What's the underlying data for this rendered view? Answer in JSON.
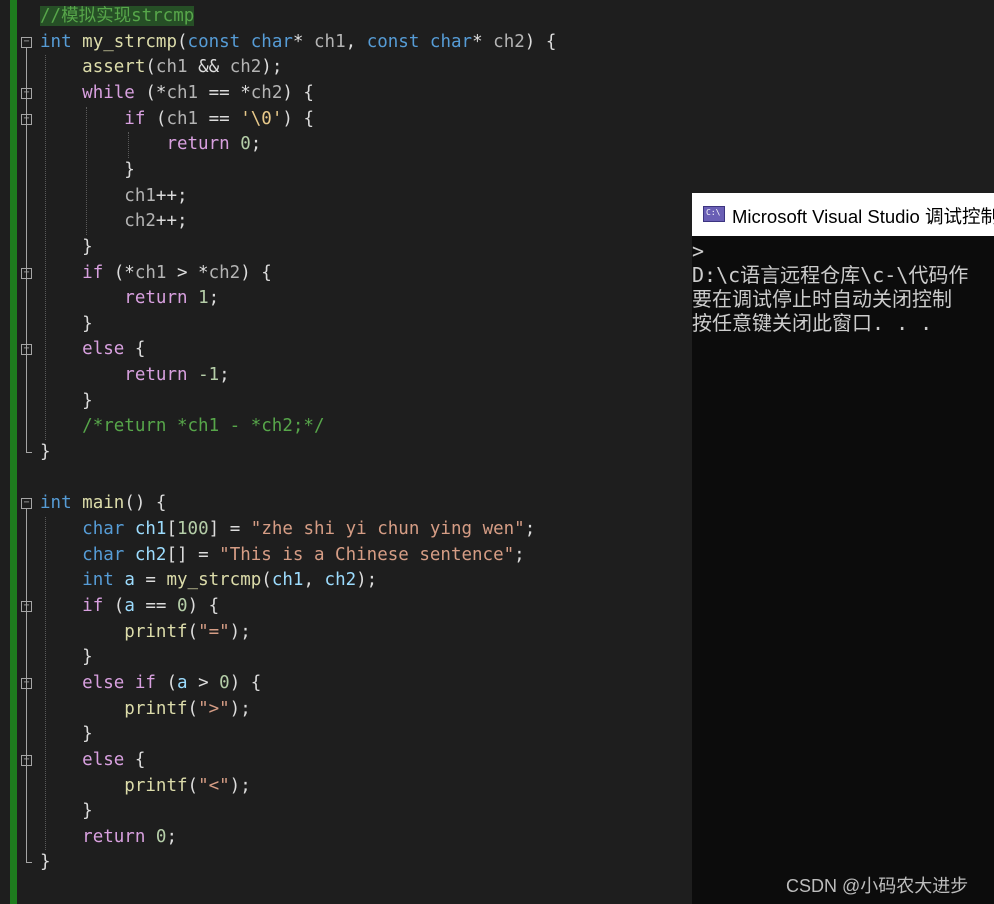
{
  "editor": {
    "lines": [
      {
        "tokens": [
          {
            "t": "//模拟实现strcmp",
            "c": "cmt cmt-hl"
          }
        ]
      },
      {
        "tokens": [
          {
            "t": "int",
            "c": "kw"
          },
          {
            "t": " ",
            "c": "plain"
          },
          {
            "t": "my_strcmp",
            "c": "fn"
          },
          {
            "t": "(",
            "c": "plain"
          },
          {
            "t": "const",
            "c": "kw"
          },
          {
            "t": " ",
            "c": "plain"
          },
          {
            "t": "char",
            "c": "kw"
          },
          {
            "t": "* ",
            "c": "plain"
          },
          {
            "t": "ch1",
            "c": "gray"
          },
          {
            "t": ", ",
            "c": "plain"
          },
          {
            "t": "const",
            "c": "kw"
          },
          {
            "t": " ",
            "c": "plain"
          },
          {
            "t": "char",
            "c": "kw"
          },
          {
            "t": "* ",
            "c": "plain"
          },
          {
            "t": "ch2",
            "c": "gray"
          },
          {
            "t": ") {",
            "c": "plain"
          }
        ]
      },
      {
        "tokens": [
          {
            "t": "    ",
            "c": "plain"
          },
          {
            "t": "assert",
            "c": "fn"
          },
          {
            "t": "(",
            "c": "plain"
          },
          {
            "t": "ch1",
            "c": "gray"
          },
          {
            "t": " && ",
            "c": "plain"
          },
          {
            "t": "ch2",
            "c": "gray"
          },
          {
            "t": ");",
            "c": "plain"
          }
        ]
      },
      {
        "tokens": [
          {
            "t": "    ",
            "c": "plain"
          },
          {
            "t": "while",
            "c": "ctl"
          },
          {
            "t": " (*",
            "c": "plain"
          },
          {
            "t": "ch1",
            "c": "gray"
          },
          {
            "t": " == *",
            "c": "plain"
          },
          {
            "t": "ch2",
            "c": "gray"
          },
          {
            "t": ") {",
            "c": "plain"
          }
        ]
      },
      {
        "tokens": [
          {
            "t": "        ",
            "c": "plain"
          },
          {
            "t": "if",
            "c": "ctl"
          },
          {
            "t": " (",
            "c": "plain"
          },
          {
            "t": "ch1",
            "c": "gray"
          },
          {
            "t": " == ",
            "c": "plain"
          },
          {
            "t": "'\\0'",
            "c": "chr"
          },
          {
            "t": ") {",
            "c": "plain"
          }
        ]
      },
      {
        "tokens": [
          {
            "t": "            ",
            "c": "plain"
          },
          {
            "t": "return",
            "c": "ctl"
          },
          {
            "t": " ",
            "c": "plain"
          },
          {
            "t": "0",
            "c": "num"
          },
          {
            "t": ";",
            "c": "plain"
          }
        ]
      },
      {
        "tokens": [
          {
            "t": "        }",
            "c": "plain"
          }
        ]
      },
      {
        "tokens": [
          {
            "t": "        ",
            "c": "plain"
          },
          {
            "t": "ch1",
            "c": "gray"
          },
          {
            "t": "++;",
            "c": "plain"
          }
        ]
      },
      {
        "tokens": [
          {
            "t": "        ",
            "c": "plain"
          },
          {
            "t": "ch2",
            "c": "gray"
          },
          {
            "t": "++;",
            "c": "plain"
          }
        ]
      },
      {
        "tokens": [
          {
            "t": "    }",
            "c": "plain"
          }
        ]
      },
      {
        "tokens": [
          {
            "t": "    ",
            "c": "plain"
          },
          {
            "t": "if",
            "c": "ctl"
          },
          {
            "t": " (*",
            "c": "plain"
          },
          {
            "t": "ch1",
            "c": "gray"
          },
          {
            "t": " > *",
            "c": "plain"
          },
          {
            "t": "ch2",
            "c": "gray"
          },
          {
            "t": ") {",
            "c": "plain"
          }
        ]
      },
      {
        "tokens": [
          {
            "t": "        ",
            "c": "plain"
          },
          {
            "t": "return",
            "c": "ctl"
          },
          {
            "t": " ",
            "c": "plain"
          },
          {
            "t": "1",
            "c": "num"
          },
          {
            "t": ";",
            "c": "plain"
          }
        ]
      },
      {
        "tokens": [
          {
            "t": "    }",
            "c": "plain"
          }
        ]
      },
      {
        "tokens": [
          {
            "t": "    ",
            "c": "plain"
          },
          {
            "t": "else",
            "c": "ctl"
          },
          {
            "t": " {",
            "c": "plain"
          }
        ]
      },
      {
        "tokens": [
          {
            "t": "        ",
            "c": "plain"
          },
          {
            "t": "return",
            "c": "ctl"
          },
          {
            "t": " ",
            "c": "plain"
          },
          {
            "t": "-1",
            "c": "num"
          },
          {
            "t": ";",
            "c": "plain"
          }
        ]
      },
      {
        "tokens": [
          {
            "t": "    }",
            "c": "plain"
          }
        ]
      },
      {
        "tokens": [
          {
            "t": "    ",
            "c": "plain"
          },
          {
            "t": "/*return *ch1 - *ch2;*/",
            "c": "cmt"
          }
        ]
      },
      {
        "tokens": [
          {
            "t": "}",
            "c": "plain"
          }
        ]
      },
      {
        "tokens": [
          {
            "t": "",
            "c": "plain"
          }
        ]
      },
      {
        "tokens": [
          {
            "t": "int",
            "c": "kw"
          },
          {
            "t": " ",
            "c": "plain"
          },
          {
            "t": "main",
            "c": "fn"
          },
          {
            "t": "() {",
            "c": "plain"
          }
        ]
      },
      {
        "tokens": [
          {
            "t": "    ",
            "c": "plain"
          },
          {
            "t": "char",
            "c": "kw"
          },
          {
            "t": " ",
            "c": "plain"
          },
          {
            "t": "ch1",
            "c": "var"
          },
          {
            "t": "[",
            "c": "plain"
          },
          {
            "t": "100",
            "c": "num"
          },
          {
            "t": "] = ",
            "c": "plain"
          },
          {
            "t": "\"zhe shi yi chun ying wen\"",
            "c": "str"
          },
          {
            "t": ";",
            "c": "plain"
          }
        ]
      },
      {
        "tokens": [
          {
            "t": "    ",
            "c": "plain"
          },
          {
            "t": "char",
            "c": "kw"
          },
          {
            "t": " ",
            "c": "plain"
          },
          {
            "t": "ch2",
            "c": "var"
          },
          {
            "t": "[] = ",
            "c": "plain"
          },
          {
            "t": "\"This is a Chinese sentence\"",
            "c": "str"
          },
          {
            "t": ";",
            "c": "plain"
          }
        ]
      },
      {
        "tokens": [
          {
            "t": "    ",
            "c": "plain"
          },
          {
            "t": "int",
            "c": "kw"
          },
          {
            "t": " ",
            "c": "plain"
          },
          {
            "t": "a",
            "c": "var"
          },
          {
            "t": " = ",
            "c": "plain"
          },
          {
            "t": "my_strcmp",
            "c": "fn"
          },
          {
            "t": "(",
            "c": "plain"
          },
          {
            "t": "ch1",
            "c": "var"
          },
          {
            "t": ", ",
            "c": "plain"
          },
          {
            "t": "ch2",
            "c": "var"
          },
          {
            "t": ");",
            "c": "plain"
          }
        ]
      },
      {
        "tokens": [
          {
            "t": "    ",
            "c": "plain"
          },
          {
            "t": "if",
            "c": "ctl"
          },
          {
            "t": " (",
            "c": "plain"
          },
          {
            "t": "a",
            "c": "var"
          },
          {
            "t": " == ",
            "c": "plain"
          },
          {
            "t": "0",
            "c": "num"
          },
          {
            "t": ") {",
            "c": "plain"
          }
        ]
      },
      {
        "tokens": [
          {
            "t": "        ",
            "c": "plain"
          },
          {
            "t": "printf",
            "c": "fn"
          },
          {
            "t": "(",
            "c": "plain"
          },
          {
            "t": "\"=\"",
            "c": "str"
          },
          {
            "t": ");",
            "c": "plain"
          }
        ]
      },
      {
        "tokens": [
          {
            "t": "    }",
            "c": "plain"
          }
        ]
      },
      {
        "tokens": [
          {
            "t": "    ",
            "c": "plain"
          },
          {
            "t": "else",
            "c": "ctl"
          },
          {
            "t": " ",
            "c": "plain"
          },
          {
            "t": "if",
            "c": "ctl"
          },
          {
            "t": " (",
            "c": "plain"
          },
          {
            "t": "a",
            "c": "var"
          },
          {
            "t": " > ",
            "c": "plain"
          },
          {
            "t": "0",
            "c": "num"
          },
          {
            "t": ") {",
            "c": "plain"
          }
        ]
      },
      {
        "tokens": [
          {
            "t": "        ",
            "c": "plain"
          },
          {
            "t": "printf",
            "c": "fn"
          },
          {
            "t": "(",
            "c": "plain"
          },
          {
            "t": "\">\"",
            "c": "str"
          },
          {
            "t": ");",
            "c": "plain"
          }
        ]
      },
      {
        "tokens": [
          {
            "t": "    }",
            "c": "plain"
          }
        ]
      },
      {
        "tokens": [
          {
            "t": "    ",
            "c": "plain"
          },
          {
            "t": "else",
            "c": "ctl"
          },
          {
            "t": " {",
            "c": "plain"
          }
        ]
      },
      {
        "tokens": [
          {
            "t": "        ",
            "c": "plain"
          },
          {
            "t": "printf",
            "c": "fn"
          },
          {
            "t": "(",
            "c": "plain"
          },
          {
            "t": "\"<\"",
            "c": "str"
          },
          {
            "t": ");",
            "c": "plain"
          }
        ]
      },
      {
        "tokens": [
          {
            "t": "    }",
            "c": "plain"
          }
        ]
      },
      {
        "tokens": [
          {
            "t": "    ",
            "c": "plain"
          },
          {
            "t": "return",
            "c": "ctl"
          },
          {
            "t": " ",
            "c": "plain"
          },
          {
            "t": "0",
            "c": "num"
          },
          {
            "t": ";",
            "c": "plain"
          }
        ]
      },
      {
        "tokens": [
          {
            "t": "}",
            "c": "plain"
          }
        ]
      }
    ],
    "fold_markers": [
      1,
      3,
      4,
      10,
      13,
      19,
      23,
      26,
      29
    ]
  },
  "console": {
    "title": "Microsoft Visual Studio 调试控制台",
    "output_lines": [
      ">",
      "D:\\c语言远程仓库\\c-\\代码作",
      "要在调试停止时自动关闭控制",
      "按任意键关闭此窗口. . ."
    ]
  },
  "watermark": "CSDN @小码农大进步",
  "colors": {
    "editor_bg": "#1e1e1e",
    "keyword": "#569cd6",
    "control": "#d8a0df",
    "function": "#dcdcaa",
    "string": "#d69d85",
    "comment": "#57a64a",
    "number": "#b5cea8",
    "change_bar": "#1e7c1e",
    "console_bg": "#0c0c0c"
  }
}
